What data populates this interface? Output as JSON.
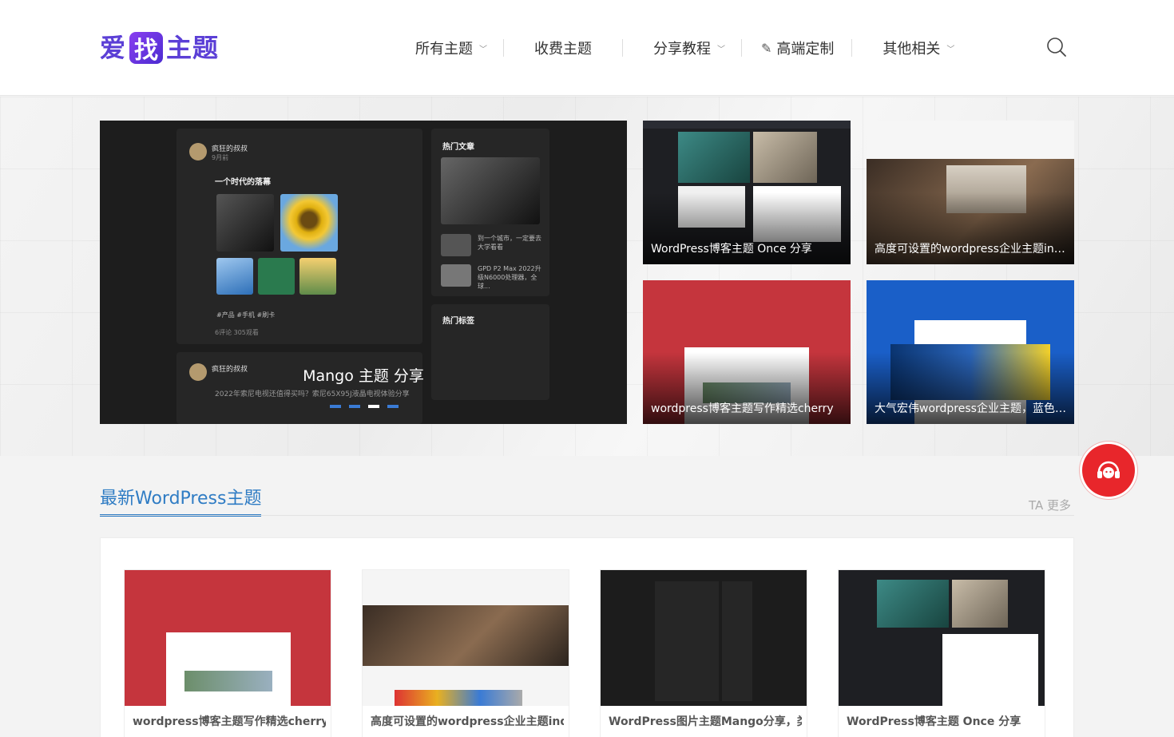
{
  "header": {
    "logo": {
      "left_text": "爱",
      "badge_text": "找",
      "right_text": "主题"
    },
    "nav": [
      {
        "label": "所有主题",
        "dropdown": true
      },
      {
        "label": "收费主题",
        "dropdown": false
      },
      {
        "label": "分享教程",
        "dropdown": true
      },
      {
        "label": "高端定制",
        "dropdown": false,
        "icon": "brush-icon"
      },
      {
        "label": "其他相关",
        "dropdown": true
      }
    ],
    "search_icon": "search-icon"
  },
  "slider": {
    "caption": "Mango 主题 分享",
    "dots": 4,
    "active_dot": 3,
    "mock": {
      "author": "疯狂的叔叔",
      "time": "9月前",
      "post_title": "一个时代的落幕",
      "tags": "#产品   #手机   #刷卡",
      "stats": "6评论    305观看",
      "hot_articles": "热门文章",
      "hot_item1": "到一个城市，一定要去大学看看",
      "hot_item2": "GPD P2 Max 2022升级N6000处理器，全球...",
      "hot_tags": "热门标签",
      "author2": "疯狂的叔叔",
      "post2": "2022年索尼电视还值得买吗？索尼65X95J液晶电视体验分享"
    }
  },
  "tiles": [
    {
      "caption": "WordPress博客主题 Once 分享"
    },
    {
      "caption": "高度可设置的wordpress企业主题indigo分享"
    },
    {
      "caption": "wordpress博客主题写作精选cherry"
    },
    {
      "caption": "大气宏伟wordpress企业主题，蓝色营销型企业模板"
    }
  ],
  "section": {
    "title": "最新WordPress主题",
    "more": "TA 更多",
    "cards": [
      {
        "title": "wordpress博客主题写作精选cherry"
      },
      {
        "title": "高度可设置的wordpress企业主题indigo分享"
      },
      {
        "title": "WordPress图片主题Mango分享，类似小红书"
      },
      {
        "title": "WordPress博客主题 Once 分享"
      }
    ]
  },
  "colors": {
    "accent": "#2f7cc4",
    "logo": "#5b3fd6",
    "service": "#e8262b"
  }
}
